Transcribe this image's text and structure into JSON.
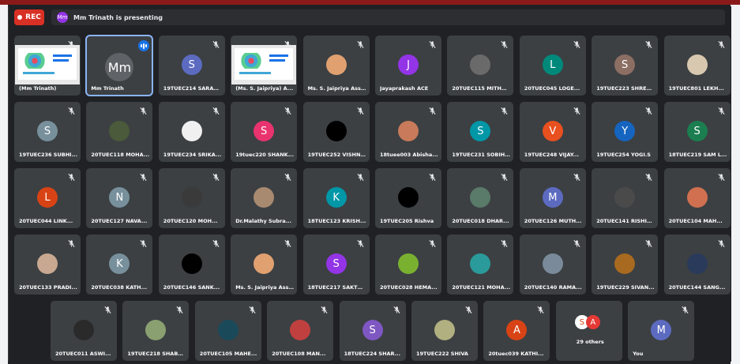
{
  "topbar": {
    "rec_label": "REC",
    "presenter_initials": "Mm",
    "presenter_text": "Mm Trinath is presenting"
  },
  "colors": {
    "tile_bg": "#3c4043",
    "page_bg": "#202124",
    "rec": "#d93025",
    "speaking_outline": "#8ab4f8"
  },
  "tiles": [
    {
      "name": "(Mm Trinath)",
      "kind": "screen",
      "muted": true
    },
    {
      "name": "Mm Trinath",
      "kind": "avatar",
      "initial": "Mm",
      "color": "#5f6368",
      "muted": false,
      "speaking": true
    },
    {
      "name": "19TUEC214 SARAN...",
      "kind": "avatar",
      "initial": "S",
      "color": "#5c6bc0",
      "muted": true
    },
    {
      "name": "(Ms. S. Jaipriya) A...",
      "kind": "screen",
      "muted": true
    },
    {
      "name": "Ms. S. Jaipriya Ass...",
      "kind": "photo",
      "color": "#e0a070",
      "muted": true
    },
    {
      "name": "Jayaprakash ACE",
      "kind": "avatar",
      "initial": "J",
      "color": "#9334e6",
      "muted": true
    },
    {
      "name": "20TUEC115 MITHU...",
      "kind": "photo",
      "color": "#6a6a6a",
      "muted": true
    },
    {
      "name": "20TUEC045 LOGE...",
      "kind": "avatar",
      "initial": "L",
      "color": "#00897b",
      "muted": true
    },
    {
      "name": "19TUEC223 SHREE...",
      "kind": "avatar",
      "initial": "S",
      "color": "#8d6e63",
      "muted": true
    },
    {
      "name": "19TUEC801 LEKH...",
      "kind": "photo",
      "color": "#d8c8b0",
      "muted": true
    },
    {
      "name": "19TUEC236 SUBHI...",
      "kind": "avatar",
      "initial": "S",
      "color": "#78909c",
      "muted": true
    },
    {
      "name": "20TUEC118 MOHA...",
      "kind": "photo",
      "color": "#4a5a3a",
      "muted": true
    },
    {
      "name": "19TUEC234 SRIKA...",
      "kind": "photo",
      "color": "#f0f0f0",
      "muted": true
    },
    {
      "name": "19tuec220 SHANK...",
      "kind": "avatar",
      "initial": "S",
      "color": "#e8336f",
      "muted": true
    },
    {
      "name": "19TUEC252 VISHN...",
      "kind": "photo",
      "color": "#000000",
      "muted": true
    },
    {
      "name": "18tuee003 Abisha...",
      "kind": "photo",
      "color": "#c87a5a",
      "muted": true
    },
    {
      "name": "19TUEC231 SOBIH...",
      "kind": "avatar",
      "initial": "S",
      "color": "#0097a7",
      "muted": true
    },
    {
      "name": "19TUEC248 VIJAY...",
      "kind": "avatar",
      "initial": "V",
      "color": "#e8501f",
      "muted": true
    },
    {
      "name": "19TUEC254 YOGI.S",
      "kind": "avatar",
      "initial": "Y",
      "color": "#1565c0",
      "muted": true
    },
    {
      "name": "18TUEC219 SAM L...",
      "kind": "avatar",
      "initial": "S",
      "color": "#1b7e50",
      "muted": true
    },
    {
      "name": "20TUEC044 LINK...",
      "kind": "avatar",
      "initial": "L",
      "color": "#d84315",
      "muted": true
    },
    {
      "name": "20TUEC127 NAVA...",
      "kind": "avatar",
      "initial": "N",
      "color": "#78909c",
      "muted": true
    },
    {
      "name": "20TUEC120 MOH...",
      "kind": "photo",
      "color": "#3a3a3a",
      "muted": true
    },
    {
      "name": "Dr.Malathy Subra...",
      "kind": "photo",
      "color": "#a88a70",
      "muted": true
    },
    {
      "name": "18TUEC123 KRISH...",
      "kind": "avatar",
      "initial": "K",
      "color": "#0097a7",
      "muted": true
    },
    {
      "name": "19TUEC205 Rishva",
      "kind": "photo",
      "color": "#000000",
      "muted": true
    },
    {
      "name": "20TUEC018 DHAR...",
      "kind": "photo",
      "color": "#5a7a6a",
      "muted": true
    },
    {
      "name": "20TUEC126 MUTH...",
      "kind": "avatar",
      "initial": "M",
      "color": "#5c6bc0",
      "muted": true
    },
    {
      "name": "20TUEC141 RISHIK...",
      "kind": "photo",
      "color": "#4a4a4a",
      "muted": true
    },
    {
      "name": "20TUEC104 MAH...",
      "kind": "photo",
      "color": "#d07050",
      "muted": true
    },
    {
      "name": "20TUEC133 PRADI...",
      "kind": "photo",
      "color": "#c8a890",
      "muted": true
    },
    {
      "name": "20TUEC038 KATH...",
      "kind": "avatar",
      "initial": "K",
      "color": "#78909c",
      "muted": true
    },
    {
      "name": "20TUEC146 SANK...",
      "kind": "photo",
      "color": "#000000",
      "muted": true
    },
    {
      "name": "Ms. S. Jaipriya Ass...",
      "kind": "photo",
      "color": "#e0a070",
      "muted": true
    },
    {
      "name": "18TUEC217 SAKTH...",
      "kind": "avatar",
      "initial": "S",
      "color": "#9334e6",
      "muted": true
    },
    {
      "name": "20TUEC028 HEMA...",
      "kind": "photo",
      "color": "#7ab030",
      "muted": true
    },
    {
      "name": "20TUEC121 MOHA...",
      "kind": "photo",
      "color": "#2a9a9a",
      "muted": true
    },
    {
      "name": "20TUEC140 RAMA...",
      "kind": "photo",
      "color": "#7a8a9a",
      "muted": true
    },
    {
      "name": "19TUEC229 SIVAN...",
      "kind": "photo",
      "color": "#a86a20",
      "muted": true
    },
    {
      "name": "20TUEC144 SANG...",
      "kind": "photo",
      "color": "#2a3a5a",
      "muted": true
    },
    {
      "name": "20TUEC011 ASWI...",
      "kind": "photo",
      "color": "#2a2a2a",
      "muted": true
    },
    {
      "name": "19TUEC218 SHABE...",
      "kind": "photo",
      "color": "#8aa070",
      "muted": true
    },
    {
      "name": "20TUEC105 MAHE...",
      "kind": "photo",
      "color": "#1a4a5a",
      "muted": true
    },
    {
      "name": "20TUEC108 MAN...",
      "kind": "photo",
      "color": "#c04040",
      "muted": true
    },
    {
      "name": "18TUEC224 SHAR...",
      "kind": "avatar",
      "initial": "S",
      "color": "#7e57c2",
      "muted": true
    },
    {
      "name": "19TUEC222 SHIVA",
      "kind": "photo",
      "color": "#b0b080",
      "muted": true
    },
    {
      "name": "20tuec039 KATHI...",
      "kind": "avatar",
      "initial": "A",
      "color": "#d84315",
      "muted": true
    },
    {
      "name": "29 others",
      "kind": "others",
      "muted": false
    },
    {
      "name": "You",
      "kind": "avatar",
      "initial": "M",
      "color": "#5c6bc0",
      "muted": true
    }
  ]
}
